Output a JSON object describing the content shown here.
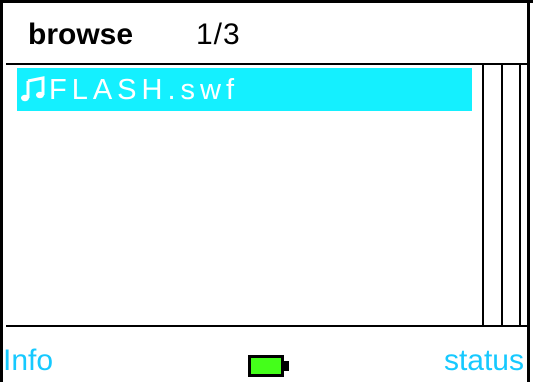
{
  "header": {
    "title": "browse",
    "page_indicator": "1/3"
  },
  "file_list": {
    "items": [
      {
        "name": "FLASH.swf",
        "icon": "music-note-icon",
        "selected": true
      }
    ]
  },
  "footer": {
    "left_softkey": "Info",
    "right_softkey": "status",
    "battery_icon": "battery-icon"
  },
  "colors": {
    "selection_highlight": "#14f0ff",
    "softkey_text": "#16c9ff",
    "battery_fill": "#44ff1a"
  }
}
